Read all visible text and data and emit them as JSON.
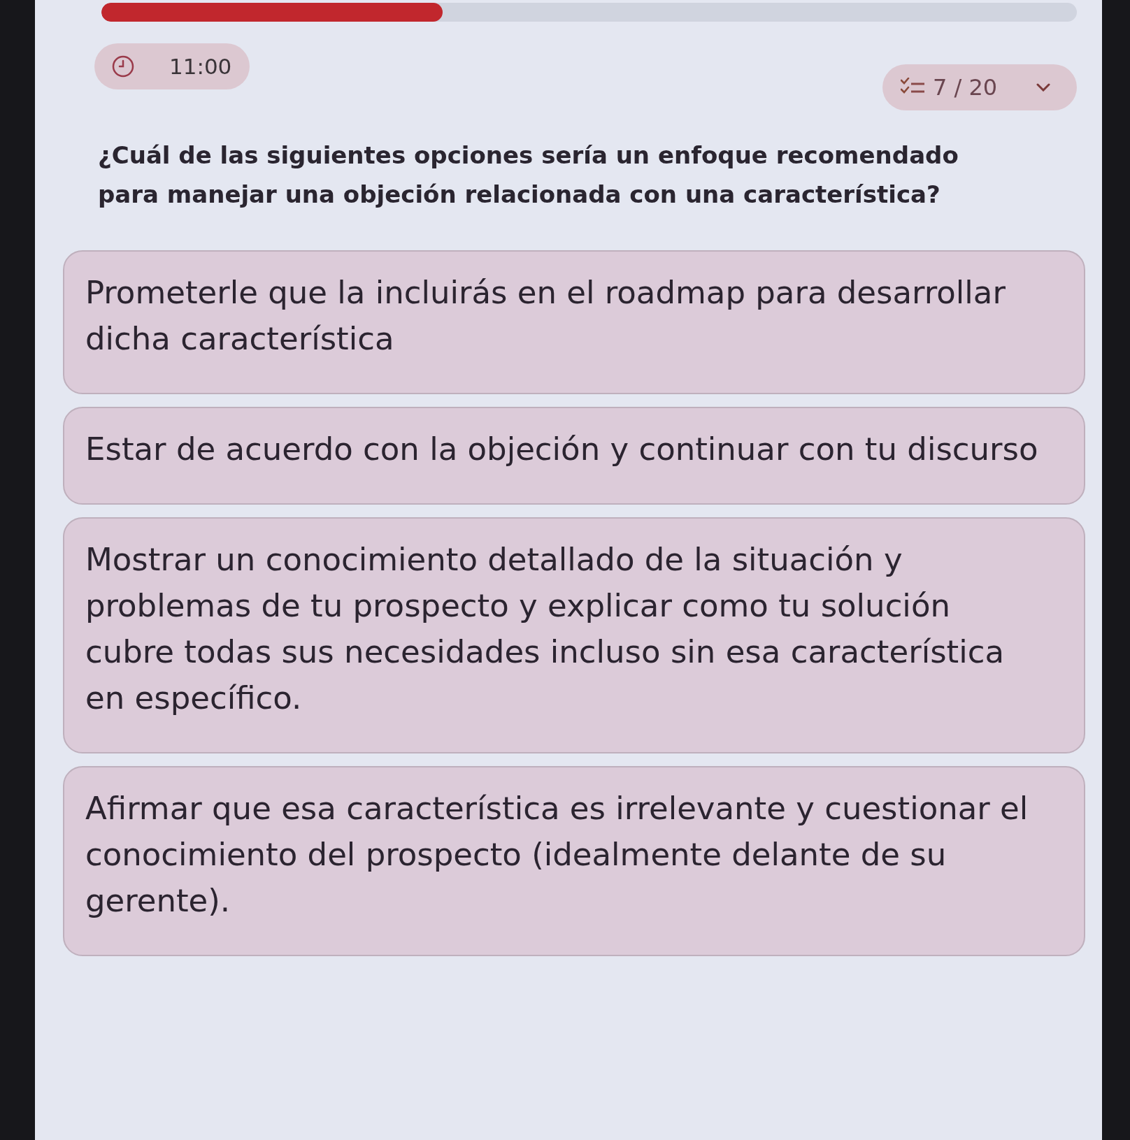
{
  "progress": {
    "level": 0.35
  },
  "timer": {
    "text": "11:00"
  },
  "question_counter": {
    "text": "7 / 20"
  },
  "question": "¿Cuál de las siguientes opciones sería un enfoque recomendado para manejar una objeción relacionada con una característica?",
  "options": [
    {
      "text": "Prometerle que la incluirás en el roadmap para desarrollar dicha característica"
    },
    {
      "text": "Estar de acuerdo con la objeción y continuar con tu discurso"
    },
    {
      "text": "Mostrar un conocimiento detallado de la situación y problemas de tu prospecto y explicar como tu solución cubre todas sus necesidades incluso sin esa característica en específico."
    },
    {
      "text": "Afirmar que esa característica es irrelevante y cuestionar el conocimiento del prospecto (idealmente delante de su gerente)."
    }
  ]
}
